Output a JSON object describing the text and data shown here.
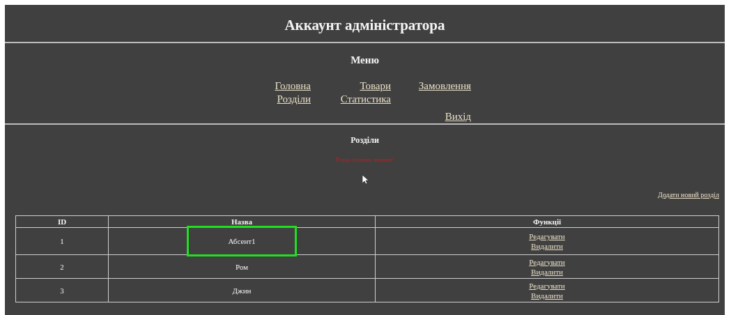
{
  "title": "Аккаунт адміністратора",
  "menu": {
    "heading": "Меню",
    "rows": [
      [
        {
          "label": "Головна"
        },
        {
          "label": "Товари"
        },
        {
          "label": "Замовлення"
        }
      ],
      [
        {
          "label": "Розділи"
        },
        {
          "label": "Статистика"
        },
        null
      ],
      [
        null,
        null,
        {
          "label": "Вихід"
        }
      ]
    ]
  },
  "section": {
    "heading": "Розділи",
    "message": "Розділ успішно змінено!",
    "add_link": "Додати новий розділ"
  },
  "table": {
    "columns": [
      "ID",
      "Назва",
      "Функції"
    ],
    "rows": [
      {
        "id": "1",
        "name": "Абсент1",
        "actions": [
          "Редагувати",
          "Видалити"
        ],
        "highlighted": true
      },
      {
        "id": "2",
        "name": "Ром",
        "actions": [
          "Редагувати",
          "Видалити"
        ],
        "highlighted": false
      },
      {
        "id": "3",
        "name": "Джин",
        "actions": [
          "Редагувати",
          "Видалити"
        ],
        "highlighted": false
      }
    ]
  }
}
